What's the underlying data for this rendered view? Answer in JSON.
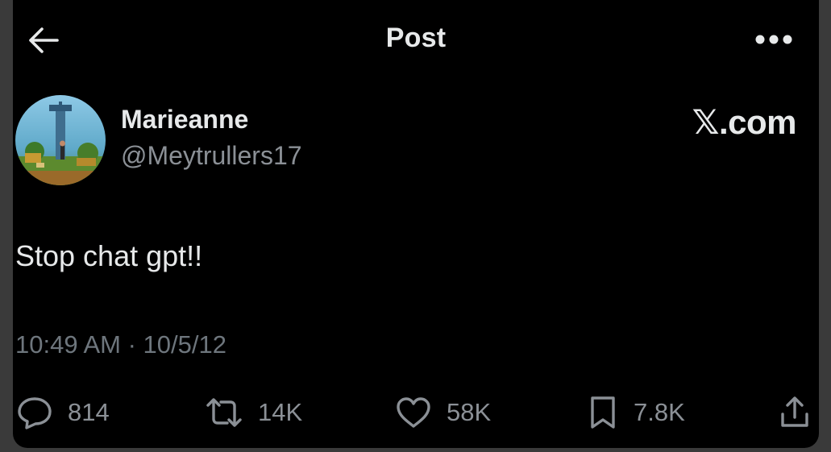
{
  "header": {
    "title": "Post"
  },
  "author": {
    "name": "Marieanne",
    "handle": "@Meytrullers17"
  },
  "watermark": "𝕏.com",
  "post": {
    "text": "Stop chat gpt!!",
    "timestamp": "10:49 AM · 10/5/12"
  },
  "actions": {
    "replies": "814",
    "reposts": "14K",
    "likes": "58K",
    "bookmarks": "7.8K"
  },
  "icons": {
    "back": "arrow-left-icon",
    "more": "more-horizontal-icon",
    "reply": "reply-icon",
    "repost": "repost-icon",
    "like": "heart-icon",
    "bookmark": "bookmark-icon",
    "share": "share-icon"
  },
  "colors": {
    "background": "#000000",
    "primary_text": "#e7e9ea",
    "secondary_text": "#8b9096",
    "meta_text": "#6e767d"
  }
}
